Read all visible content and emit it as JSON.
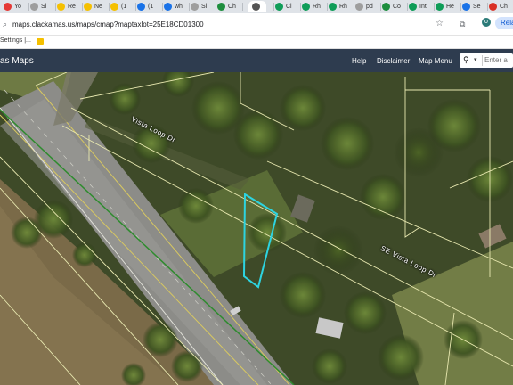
{
  "browser": {
    "tabs": [
      {
        "label": "Yo",
        "color": "#e53935"
      },
      {
        "label": "Si",
        "color": "#9e9e9e"
      },
      {
        "label": "Re",
        "color": "#f5c000"
      },
      {
        "label": "Ne",
        "color": "#f5c000"
      },
      {
        "label": "(1",
        "color": "#f5c000"
      },
      {
        "label": "(1",
        "color": "#1a73e8"
      },
      {
        "label": "wh",
        "color": "#1a73e8"
      },
      {
        "label": "Si",
        "color": "#9e9e9e"
      },
      {
        "label": "Ch",
        "color": "#1e8e3e"
      },
      {
        "label": "",
        "color": "#555555"
      },
      {
        "label": "Cl",
        "color": "#0f9d58"
      },
      {
        "label": "Rh",
        "color": "#0f9d58"
      },
      {
        "label": "Rh",
        "color": "#0f9d58"
      },
      {
        "label": "pd",
        "color": "#9e9e9e"
      },
      {
        "label": "Co",
        "color": "#1e8e3e"
      },
      {
        "label": "Int",
        "color": "#0f9d58"
      },
      {
        "label": "He",
        "color": "#0f9d58"
      },
      {
        "label": "Se",
        "color": "#1a73e8"
      },
      {
        "label": "Ch",
        "color": "#d93025"
      }
    ],
    "url": "maps.clackamas.us/maps/cmap?maptaxlot=25E18CD01300",
    "profile_initial": "o",
    "relaunch_label": "Rela",
    "bookmarks": {
      "settings": "Settings |..."
    }
  },
  "app": {
    "title": "as Maps",
    "nav": {
      "help": "Help",
      "disclaimer": "Disclaimer",
      "map_menu": "Map Menu"
    },
    "search": {
      "placeholder": "Enter a"
    }
  },
  "map": {
    "labels": {
      "road_upper": "Vista Loop Dr",
      "road_lower": "SE Vista Loop Dr"
    },
    "colors": {
      "parcel_lines": "#e8e8b0",
      "selected_parcel": "#2dd4e0",
      "highway_line": "#2e8b2e"
    }
  }
}
